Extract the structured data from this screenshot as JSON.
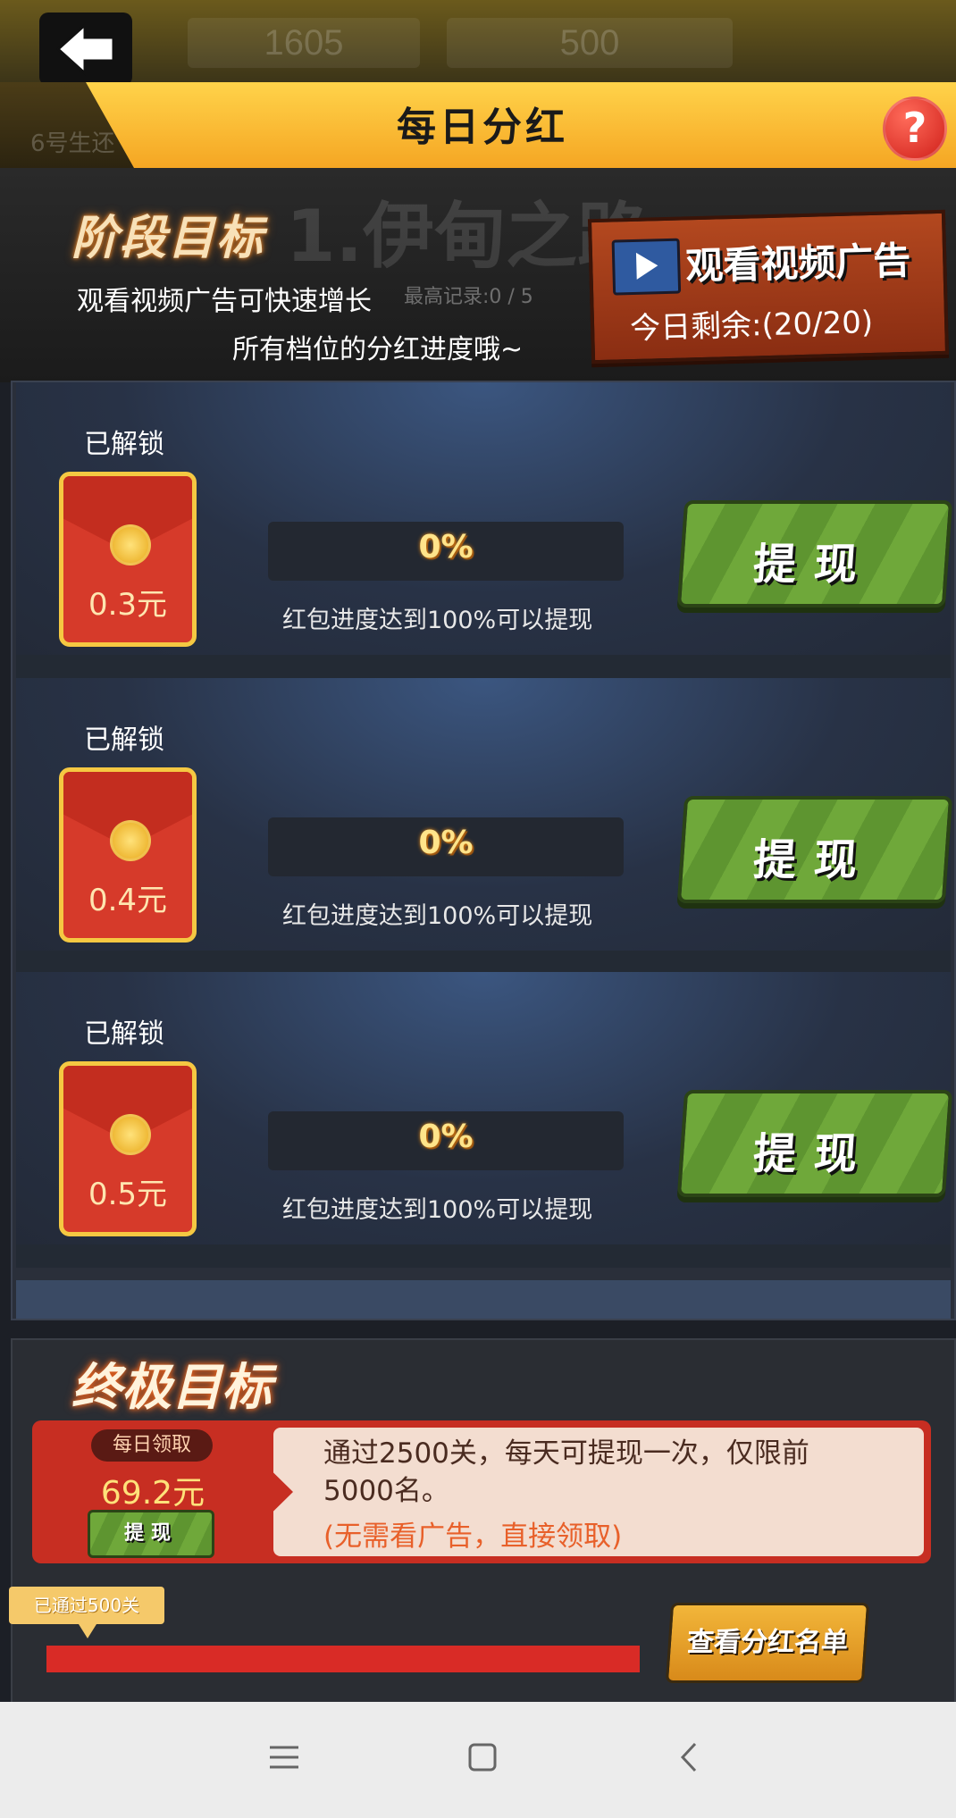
{
  "header": {
    "title": "每日分红",
    "help_symbol": "?",
    "ghost_stats": [
      "1605",
      "500"
    ],
    "ghost_level": "6号生还"
  },
  "stage": {
    "title": "阶段目标",
    "ghost_name": "1.伊甸之路",
    "desc_line1": "观看视频广告可快速增长",
    "desc_line2": "所有档位的分红进度哦~",
    "record": "最高记录:0 / 5"
  },
  "ad_panel": {
    "title": "观看视频广告",
    "remaining": "今日剩余:(20/20)"
  },
  "rewards": [
    {
      "status": "已解锁",
      "amount": "0.3元",
      "progress": "0%",
      "hint": "红包进度达到100%可以提现",
      "button": "提现"
    },
    {
      "status": "已解锁",
      "amount": "0.4元",
      "progress": "0%",
      "hint": "红包进度达到100%可以提现",
      "button": "提现"
    },
    {
      "status": "已解锁",
      "amount": "0.5元",
      "progress": "0%",
      "hint": "红包进度达到100%可以提现",
      "button": "提现"
    }
  ],
  "final_goal": {
    "title": "终极目标",
    "daily_badge": "每日领取",
    "daily_amount": "69.2元",
    "withdraw": "提现",
    "description": "通过2500关，每天可提现一次，仅限前5000名。",
    "note": "(无需看广告，直接领取)",
    "passed": "已通过500关",
    "list_button": "查看分红名单"
  },
  "colors": {
    "banner": "#f5a623",
    "withdraw_green": "#6fa83a",
    "envelope_red": "#d63a2a",
    "progress_red": "#d92b26"
  }
}
